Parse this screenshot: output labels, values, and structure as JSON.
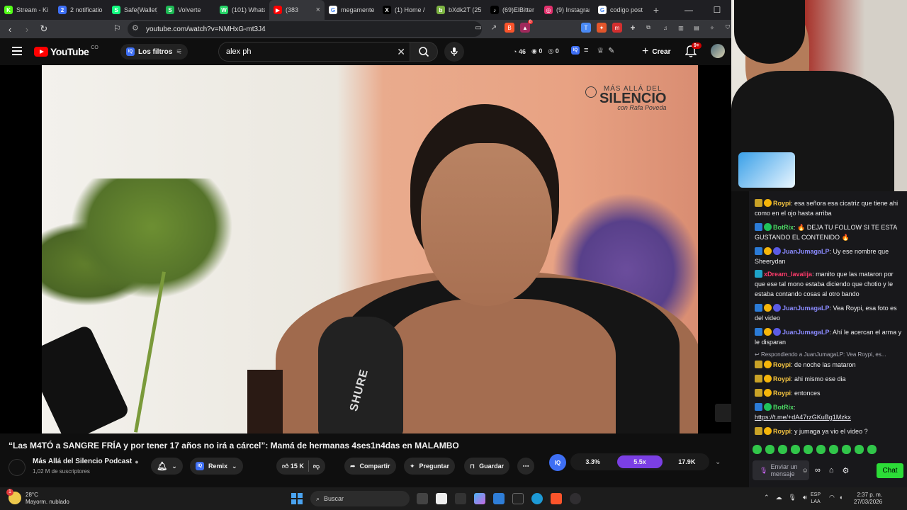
{
  "browser": {
    "tabs": [
      {
        "title": "Stream - Ki",
        "color": "#53fc18",
        "glyph": "K"
      },
      {
        "title": "2 notificatio",
        "color": "#3e6ff4",
        "glyph": "2"
      },
      {
        "title": "Safe{Wallet}",
        "color": "#12ff80",
        "glyph": "S"
      },
      {
        "title": "Volverte",
        "color": "#1db954",
        "glyph": "S"
      },
      {
        "title": "(101) Whats",
        "color": "#25d366",
        "glyph": "W"
      },
      {
        "title": "(383",
        "color": "#ff0000",
        "glyph": "▶"
      },
      {
        "title": "megamente",
        "color": "#ffffff",
        "glyph": "G"
      },
      {
        "title": "(1) Home /",
        "color": "#000000",
        "glyph": "X"
      },
      {
        "title": "bXdk2T (25",
        "color": "#7cb342",
        "glyph": "b"
      },
      {
        "title": "(69)ElBitter",
        "color": "#000000",
        "glyph": "♪"
      },
      {
        "title": "(9) Instagram",
        "color": "#e1306c",
        "glyph": "◎"
      },
      {
        "title": "codigo post",
        "color": "#ffffff",
        "glyph": "G"
      }
    ],
    "url": "youtube.com/watch?v=NMHxG-mt3J4",
    "brave_badge": "8"
  },
  "youtube": {
    "logo": "YouTube",
    "country": "CO",
    "filters_label": "Los filtros",
    "search_value": "alex ph",
    "stats": {
      "views": "46",
      "a": "0",
      "b": "0"
    },
    "create_label": "Crear",
    "notifications": "9+"
  },
  "video": {
    "watermark_line1": "MÁS ALLÁ DEL",
    "watermark_line2": "SILENCIO",
    "watermark_line3": "con Rafa Poveda",
    "mic_brand": "SHURE",
    "title": "“Las M4TÓ a SANGRE FRÍA y por tener 17 años no irá a cárcel”: Mamá de hermanas 4ses1n4das en MALAMBO",
    "channel": "Más Allá del Silencio Podcast",
    "subscribers": "1,02 M de suscriptores",
    "remix_label": "Remix",
    "likes": "15 K",
    "share_label": "Compartir",
    "ask_label": "Preguntar",
    "save_label": "Guardar",
    "iq_label": "IQ",
    "rates": [
      "3.3%",
      "5.5x",
      "17.9K"
    ]
  },
  "chat": {
    "messages": [
      {
        "user": "Roypi",
        "text": ": esa señora esa cicatriz que tiene ahi como en el ojo hasta arriba"
      },
      {
        "user": "BotRix",
        "text": ": 🔥 DEJA TU FOLLOW SI TE ESTA GUSTANDO EL CONTENIDO 🔥"
      },
      {
        "user": "JuanJumagaLP",
        "text": ": Uy ese nombre que Sheerydan"
      },
      {
        "user": "xDream_lavalija",
        "text": ": manito que las mataron por que ese tal mono estaba diciendo que chotio y le estaba contando cosas al otro bando"
      },
      {
        "user": "JuanJumagaLP",
        "text": ": Vea Roypi, esa foto es del video"
      },
      {
        "user": "JuanJumagaLP",
        "text": ": Ahí le acercan el arma y le disparan"
      },
      {
        "user": "Roypi",
        "text": ": de noche las mataron"
      },
      {
        "user": "Roypi",
        "text": ": ahi mismo ese dia"
      },
      {
        "user": "Roypi",
        "text": ": entonces"
      },
      {
        "user": "BotRix",
        "text": ":"
      },
      {
        "user": "Roypi",
        "text": ": y jumaga ya vio el video ?"
      }
    ],
    "replying_to": "Respondiendo a JuanJumagaLP: Vea Roypi, es...",
    "link": "https://t.me/+dA47rzGKuBg1Mzkx",
    "input_placeholder": "Enviar un mensaje",
    "chat_button": "Chat"
  },
  "taskbar": {
    "temperature": "28°C",
    "weather": "Mayorm. nublado",
    "weather_badge": "1",
    "search_placeholder": "Buscar",
    "lang": "ESP",
    "lang2": "LAA",
    "time": "2:37 p. m.",
    "date": "27/03/2026"
  }
}
